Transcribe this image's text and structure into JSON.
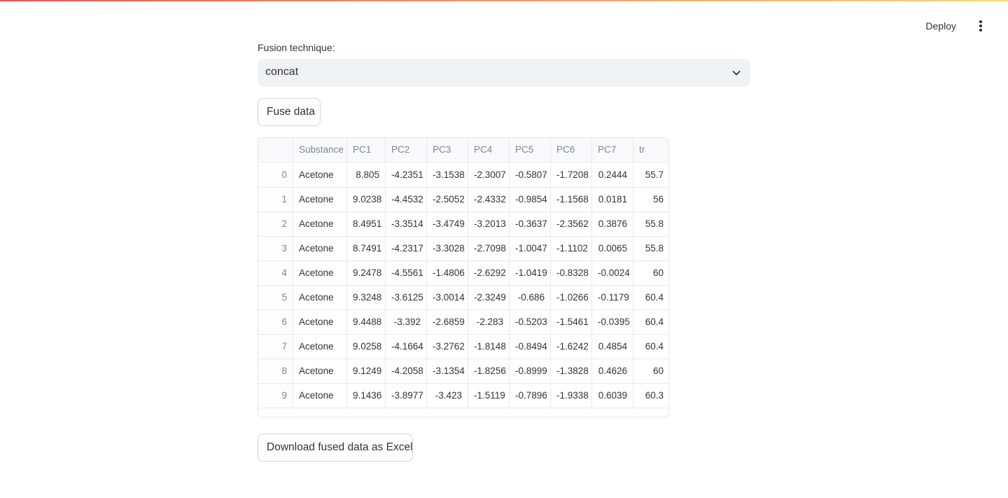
{
  "header": {
    "deploy_label": "Deploy",
    "menu_icon": "more-vertical-icon"
  },
  "fusion": {
    "label": "Fusion technique:",
    "selected": "concat",
    "icon": "chevron-down-icon"
  },
  "fuse_button": "Fuse data",
  "download_button": "Download fused data as Excel",
  "table": {
    "columns": [
      "",
      "Substance",
      "PC1",
      "PC2",
      "PC3",
      "PC4",
      "PC5",
      "PC6",
      "PC7",
      "tr"
    ],
    "rows": [
      [
        "0",
        "Acetone",
        "8.805",
        "-4.2351",
        "-3.1538",
        "-2.3007",
        "-0.5807",
        "-1.7208",
        "0.2444",
        "55.7"
      ],
      [
        "1",
        "Acetone",
        "9.0238",
        "-4.4532",
        "-2.5052",
        "-2.4332",
        "-0.9854",
        "-1.1568",
        "0.0181",
        "56"
      ],
      [
        "2",
        "Acetone",
        "8.4951",
        "-3.3514",
        "-3.4749",
        "-3.2013",
        "-0.3637",
        "-2.3562",
        "0.3876",
        "55.8"
      ],
      [
        "3",
        "Acetone",
        "8.7491",
        "-4.2317",
        "-3.3028",
        "-2.7098",
        "-1.0047",
        "-1.1102",
        "0.0065",
        "55.8"
      ],
      [
        "4",
        "Acetone",
        "9.2478",
        "-4.5561",
        "-1.4806",
        "-2.6292",
        "-1.0419",
        "-0.8328",
        "-0.0024",
        "60"
      ],
      [
        "5",
        "Acetone",
        "9.3248",
        "-3.6125",
        "-3.0014",
        "-2.3249",
        "-0.686",
        "-1.0266",
        "-0.1179",
        "60.4"
      ],
      [
        "6",
        "Acetone",
        "9.4488",
        "-3.392",
        "-2.6859",
        "-2.283",
        "-0.5203",
        "-1.5461",
        "-0.0395",
        "60.4"
      ],
      [
        "7",
        "Acetone",
        "9.0258",
        "-4.1664",
        "-3.2762",
        "-1.8148",
        "-0.8494",
        "-1.6242",
        "0.4854",
        "60.4"
      ],
      [
        "8",
        "Acetone",
        "9.1249",
        "-4.2058",
        "-3.1354",
        "-1.8256",
        "-0.8999",
        "-1.3828",
        "0.4626",
        "60"
      ],
      [
        "9",
        "Acetone",
        "9.1436",
        "-3.8977",
        "-3.423",
        "-1.5119",
        "-0.7896",
        "-1.9338",
        "0.6039",
        "60.3"
      ]
    ]
  }
}
